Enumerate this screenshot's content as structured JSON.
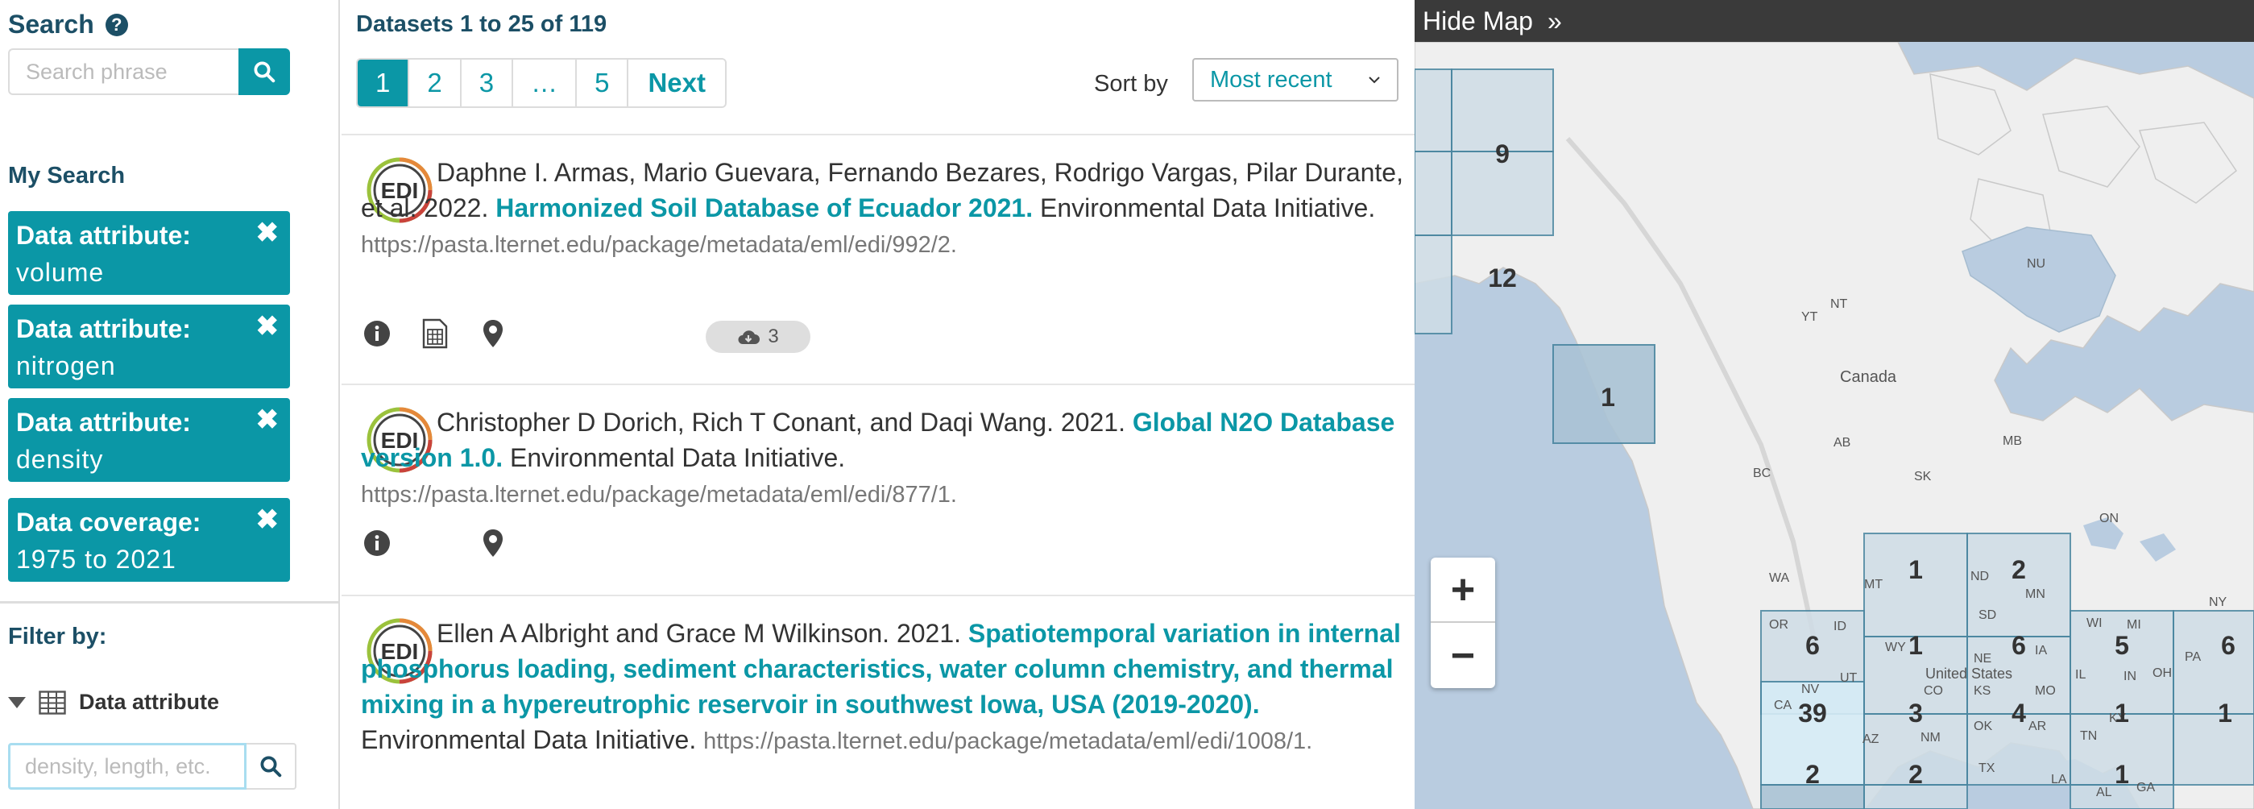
{
  "sidebar": {
    "search_title": "Search",
    "help_glyph": "?",
    "search_placeholder": "Search phrase",
    "my_search_title": "My Search",
    "chips": [
      {
        "key": "Data attribute:",
        "value": "volume"
      },
      {
        "key": "Data attribute:",
        "value": "nitrogen"
      },
      {
        "key": "Data attribute:",
        "value": "density"
      },
      {
        "key": "Data coverage:",
        "value": "1975 to 2021"
      }
    ],
    "chip_remove_glyph": "✖",
    "filter_by": "Filter by:",
    "facet_label": "Data attribute",
    "facet_placeholder": "density, length, etc."
  },
  "results": {
    "count_text": "Datasets 1 to 25 of 119",
    "pages": [
      "1",
      "2",
      "3",
      "…",
      "5"
    ],
    "next_label": "Next",
    "sort_label": "Sort by",
    "sort_value": "Most recent",
    "items": [
      {
        "authors": "Daphne I. Armas, Mario Guevara, Fernando Bezares, Rodrigo Vargas, Pilar Durante, et al. 2022.",
        "title": "Harmonized Soil Database of Ecuador 2021.",
        "publisher": "Environmental Data Initiative.",
        "url": "https://pasta.lternet.edu/package/metadata/eml/edi/992/2.",
        "downloads": "3",
        "icons": [
          "info-icon",
          "table-icon",
          "map-marker-icon"
        ]
      },
      {
        "authors": "Christopher D Dorich, Rich T Conant, and Daqi Wang. 2021.",
        "title": "Global N2O Database version 1.0.",
        "publisher": "Environmental Data Initiative.",
        "url": "https://pasta.lternet.edu/package/metadata/eml/edi/877/1.",
        "icons": [
          "info-icon",
          "map-marker-icon"
        ]
      },
      {
        "authors": "Ellen A Albright and Grace M Wilkinson. 2021.",
        "title": "Spatiotemporal variation in internal phosphorus loading, sediment characteristics, water column chemistry, and thermal mixing in a hypereutrophic reservoir in southwest Iowa, USA (2019-2020).",
        "publisher": "Environmental Data Initiative.",
        "url": "https://pasta.lternet.edu/package/metadata/eml/edi/1008/1."
      }
    ],
    "logo_text": "EDI"
  },
  "map": {
    "hide_label": "Hide Map",
    "hide_glyph": "»",
    "zoom_in": "+",
    "zoom_out": "−",
    "country_label": "Canada",
    "country_label_us": "United States",
    "regions": [
      "NU",
      "NT",
      "YT",
      "AB",
      "BC",
      "SK",
      "MB",
      "ON",
      "WA",
      "MT",
      "ND",
      "MN",
      "OR",
      "ID",
      "WI",
      "MI",
      "PA",
      "NV",
      "CA",
      "CO",
      "NE",
      "KS",
      "MO",
      "OH",
      "KY",
      "AZ",
      "NM",
      "OK",
      "AR",
      "TN",
      "TX",
      "LA",
      "AL",
      "GA",
      "IN",
      "WY",
      "SD",
      "IA",
      "IL",
      "UT",
      "NY"
    ],
    "cell_counts": [
      "9",
      "12",
      "1",
      "1",
      "2",
      "6",
      "1",
      "6",
      "5",
      "6",
      "39",
      "3",
      "4",
      "1",
      "1",
      "2",
      "2",
      "1"
    ],
    "colors": {
      "cell_highlight": "#d6ecf6",
      "cell_default": "#cfdde6",
      "cell_border": "#4a86a0",
      "water": "#b9cce0",
      "land": "#efefef"
    }
  }
}
